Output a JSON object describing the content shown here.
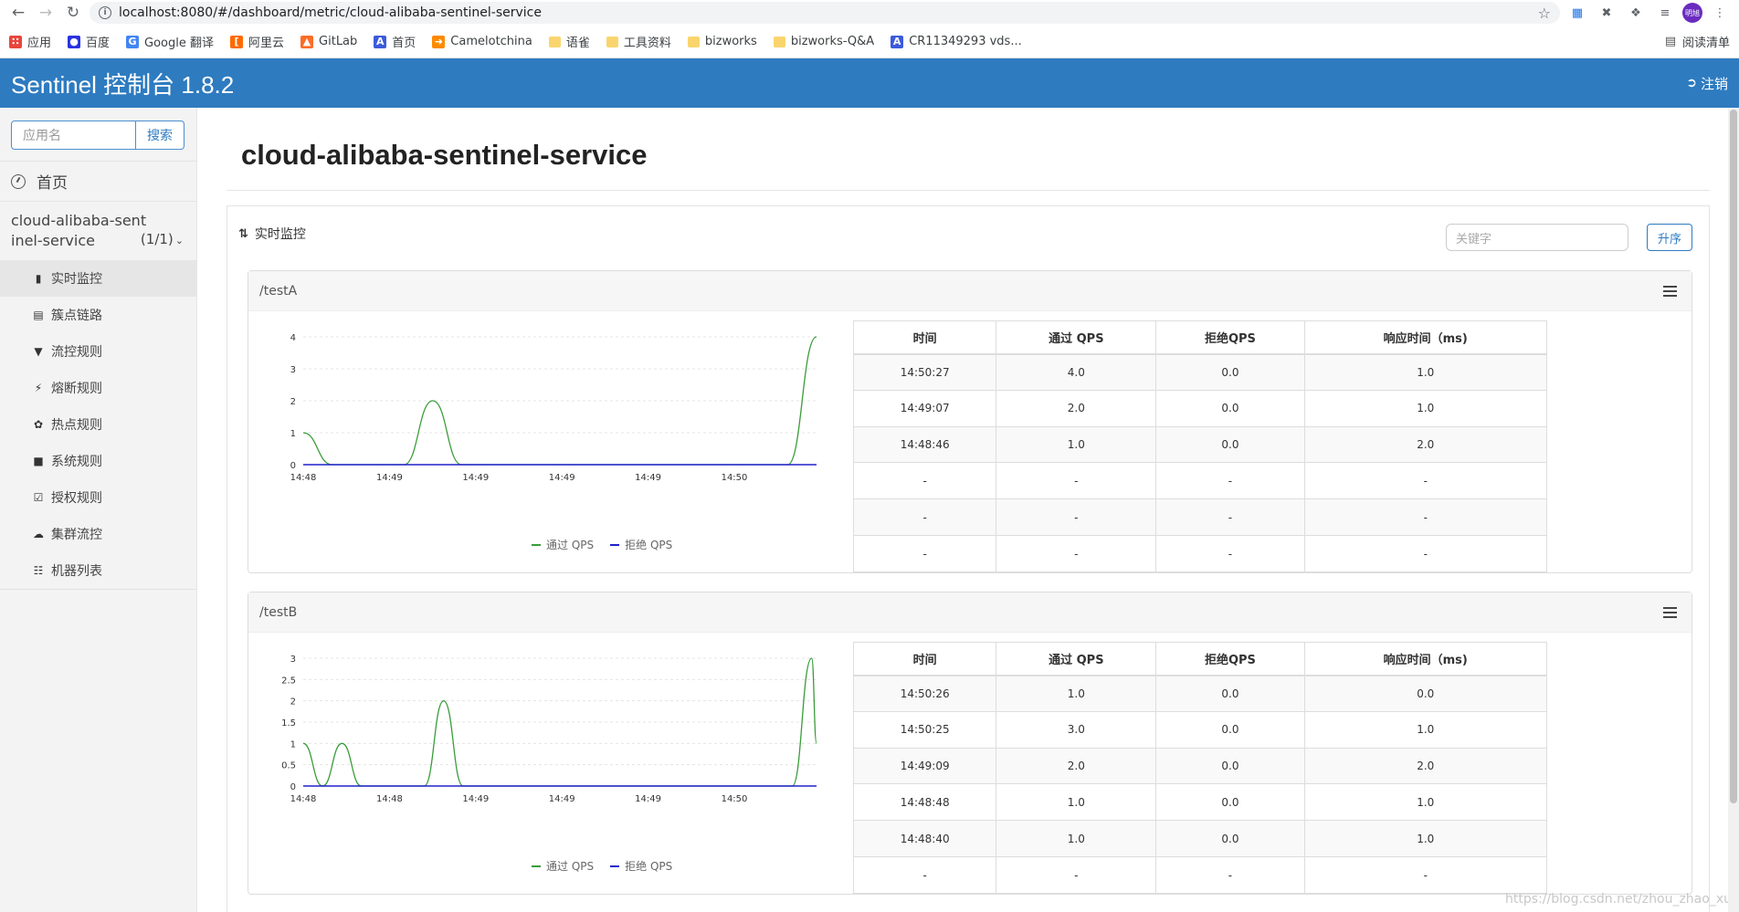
{
  "browser": {
    "url": "localhost:8080/#/dashboard/metric/cloud-alibaba-sentinel-service",
    "profile_label": "明旭",
    "bookmarks": [
      {
        "label": "应用",
        "icon": "apps-grid-icon",
        "color": "#4285f4"
      },
      {
        "label": "百度",
        "icon": "baidu-paw-icon",
        "color": "#2932e1"
      },
      {
        "label": "Google 翻译",
        "icon": "google-translate-icon",
        "color": "#4285f4"
      },
      {
        "label": "阿里云",
        "icon": "aliyun-icon",
        "color": "#ff6a00"
      },
      {
        "label": "GitLab",
        "icon": "gitlab-icon",
        "color": "#fc6d26"
      },
      {
        "label": "首页",
        "icon": "a-letter-icon",
        "color": "#3b5bdb"
      },
      {
        "label": "Camelotchina",
        "icon": "camelot-icon",
        "color": "#ff8a00"
      },
      {
        "label": "语雀",
        "icon": "folder-icon",
        "color": "#f9d56e"
      },
      {
        "label": "工具资料",
        "icon": "folder-icon",
        "color": "#f9d56e"
      },
      {
        "label": "bizworks",
        "icon": "folder-icon",
        "color": "#f9d56e"
      },
      {
        "label": "bizworks-Q&A",
        "icon": "folder-icon",
        "color": "#f9d56e"
      },
      {
        "label": "CR11349293 vds...",
        "icon": "a-letter-icon",
        "color": "#3b5bdb"
      }
    ],
    "reading_list": "阅读清单"
  },
  "header": {
    "brand": "Sentinel 控制台 1.8.2",
    "logout": "注销",
    "color": "#2e7bc0"
  },
  "sidebar": {
    "search_placeholder": "应用名",
    "search_button": "搜索",
    "home": "首页",
    "app_name": "cloud-alibaba-sentinel-service",
    "app_count": "(1/1)",
    "menu": [
      {
        "label": "实时监控",
        "icon": "bar-chart-icon",
        "active": true
      },
      {
        "label": "簇点链路",
        "icon": "list-icon",
        "active": false
      },
      {
        "label": "流控规则",
        "icon": "filter-icon",
        "active": false
      },
      {
        "label": "熔断规则",
        "icon": "bolt-icon",
        "active": false
      },
      {
        "label": "热点规则",
        "icon": "fire-icon",
        "active": false
      },
      {
        "label": "系统规则",
        "icon": "lock-icon",
        "active": false
      },
      {
        "label": "授权规则",
        "icon": "check-square-icon",
        "active": false
      },
      {
        "label": "集群流控",
        "icon": "cloud-icon",
        "active": false
      },
      {
        "label": "机器列表",
        "icon": "th-list-icon",
        "active": false
      }
    ]
  },
  "main": {
    "title": "cloud-alibaba-sentinel-service",
    "monitor_title": "实时监控",
    "keyword_placeholder": "关键字",
    "sort_button": "升序",
    "table_headers": [
      "时间",
      "通过 QPS",
      "拒绝QPS",
      "响应时间（ms)"
    ],
    "legend": {
      "pass": "通过 QPS",
      "block": "拒绝 QPS"
    },
    "colors": {
      "pass": "#3a9c3a",
      "block": "#2020cc"
    }
  },
  "resources": [
    {
      "name": "/testA",
      "rows": [
        [
          "14:50:27",
          "4.0",
          "0.0",
          "1.0"
        ],
        [
          "14:49:07",
          "2.0",
          "0.0",
          "1.0"
        ],
        [
          "14:48:46",
          "1.0",
          "0.0",
          "2.0"
        ],
        [
          "-",
          "-",
          "-",
          "-"
        ],
        [
          "-",
          "-",
          "-",
          "-"
        ],
        [
          "-",
          "-",
          "-",
          "-"
        ]
      ]
    },
    {
      "name": "/testB",
      "rows": [
        [
          "14:50:26",
          "1.0",
          "0.0",
          "0.0"
        ],
        [
          "14:50:25",
          "3.0",
          "0.0",
          "1.0"
        ],
        [
          "14:49:09",
          "2.0",
          "0.0",
          "2.0"
        ],
        [
          "14:48:48",
          "1.0",
          "0.0",
          "1.0"
        ],
        [
          "14:48:40",
          "1.0",
          "0.0",
          "1.0"
        ],
        [
          "-",
          "-",
          "-",
          "-"
        ]
      ]
    }
  ],
  "chart_data": [
    {
      "type": "line",
      "x_tick_labels": [
        "14:48",
        "14:49",
        "14:49",
        "14:49",
        "14:49",
        "14:50"
      ],
      "y_ticks": [
        0,
        1,
        2,
        3,
        4
      ],
      "ylim": [
        0,
        4
      ],
      "x": [
        "14:48:40",
        "14:48:46",
        "14:48:52",
        "14:49:01",
        "14:49:07",
        "14:49:13",
        "14:50:21",
        "14:50:27"
      ],
      "series": [
        {
          "name": "通过 QPS",
          "values": [
            1,
            0,
            0,
            0,
            2,
            0,
            0,
            4
          ]
        },
        {
          "name": "拒绝 QPS",
          "values": [
            0,
            0,
            0,
            0,
            0,
            0,
            0,
            0
          ]
        }
      ]
    },
    {
      "type": "line",
      "x_tick_labels": [
        "14:48",
        "14:48",
        "14:49",
        "14:49",
        "14:49",
        "14:50"
      ],
      "y_ticks": [
        0,
        0.5,
        1,
        1.5,
        2,
        2.5,
        3
      ],
      "ylim": [
        0,
        3
      ],
      "x": [
        "14:48:40",
        "14:48:44",
        "14:48:48",
        "14:48:52",
        "14:49:05",
        "14:49:09",
        "14:49:13",
        "14:50:21",
        "14:50:25",
        "14:50:26"
      ],
      "series": [
        {
          "name": "通过 QPS",
          "values": [
            1,
            0,
            1,
            0,
            0,
            2,
            0,
            0,
            3,
            1
          ]
        },
        {
          "name": "拒绝 QPS",
          "values": [
            0,
            0,
            0,
            0,
            0,
            0,
            0,
            0,
            0,
            0
          ]
        }
      ]
    }
  ],
  "watermark": "https://blog.csdn.net/zhou_zhao_xu"
}
